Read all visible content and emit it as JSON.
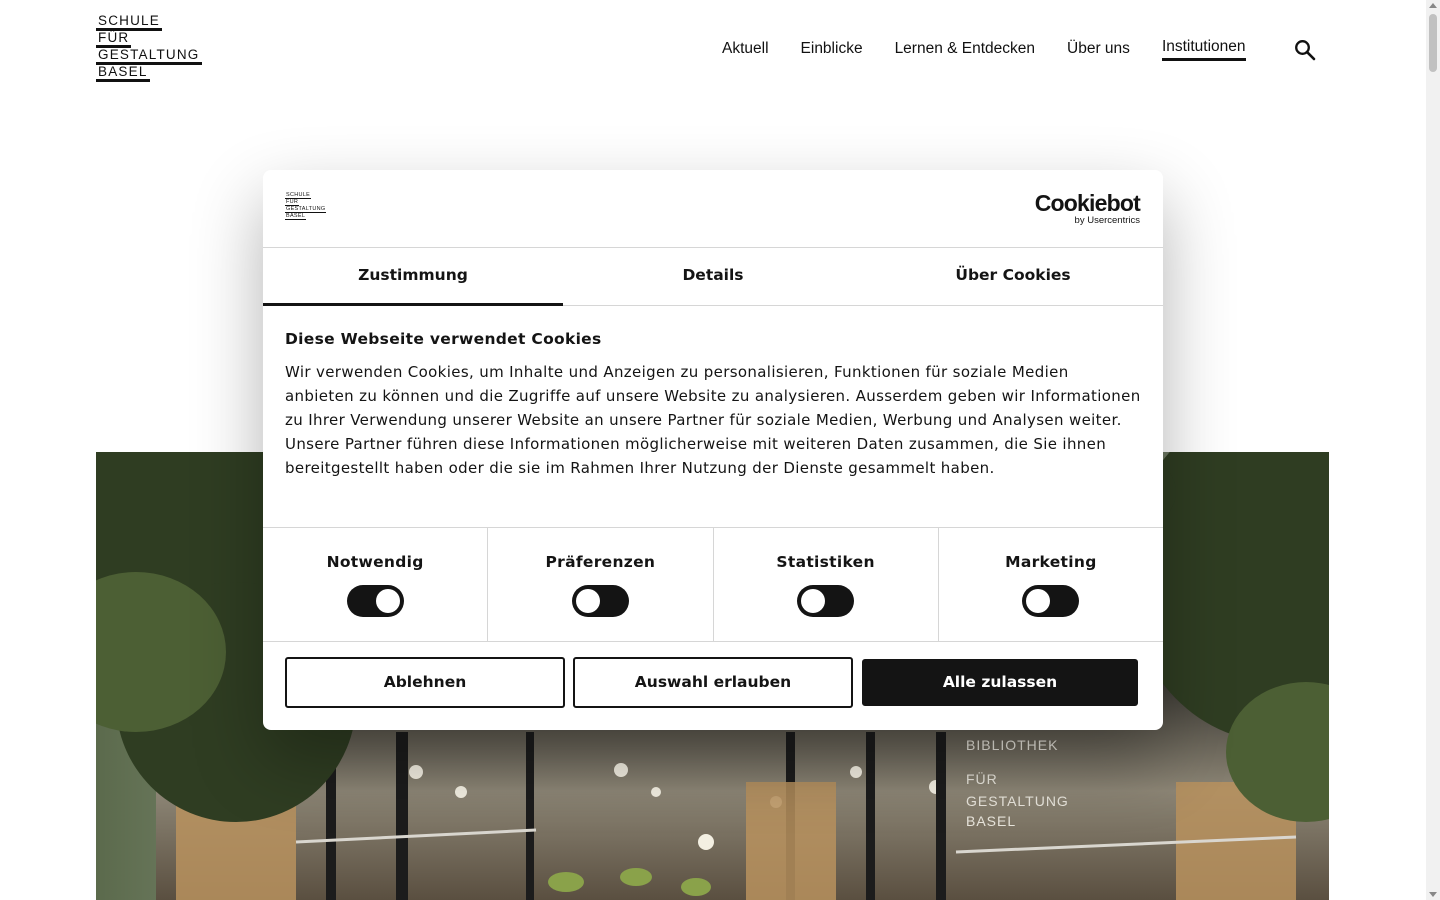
{
  "header": {
    "logo_lines": [
      "SCHULE",
      "FÜR",
      "GESTALTUNG",
      "BASEL"
    ],
    "nav": [
      "Aktuell",
      "Einblicke",
      "Lernen & Entdecken",
      "Über uns",
      "Institutionen"
    ],
    "active_nav": "Institutionen",
    "search_icon": "search-icon"
  },
  "hero": {
    "sign_lines": [
      "BIBLIOTHEK",
      "FÜR",
      "GESTALTUNG",
      "BASEL"
    ]
  },
  "cookie_dialog": {
    "logo_lines": [
      "SCHULE",
      "FÜR",
      "GESTALTUNG",
      "BASEL"
    ],
    "brand": "Cookiebot",
    "brand_sub": "by Usercentrics",
    "tabs": [
      "Zustimmung",
      "Details",
      "Über Cookies"
    ],
    "active_tab": "Zustimmung",
    "title": "Diese Webseite verwendet Cookies",
    "text": "Wir verwenden Cookies, um Inhalte und Anzeigen zu personalisieren, Funktionen für soziale Medien anbieten zu können und die Zugriffe auf unsere Website zu analysieren. Ausserdem geben wir Informationen zu Ihrer Verwendung unserer Website an unsere Partner für soziale Medien, Werbung und Analysen weiter. Unsere Partner führen diese Informationen möglicherweise mit weiteren Daten zusammen, die Sie ihnen bereitgestellt haben oder die sie im Rahmen Ihrer Nutzung der Dienste gesammelt haben.",
    "categories": [
      {
        "label": "Notwendig",
        "on": true
      },
      {
        "label": "Präferenzen",
        "on": false
      },
      {
        "label": "Statistiken",
        "on": false
      },
      {
        "label": "Marketing",
        "on": false
      }
    ],
    "buttons": {
      "reject": "Ablehnen",
      "allow_selection": "Auswahl erlauben",
      "allow_all": "Alle zulassen"
    }
  },
  "colors": {
    "text": "#141414",
    "toggle": "#141414",
    "divider": "#d6d6d6"
  }
}
